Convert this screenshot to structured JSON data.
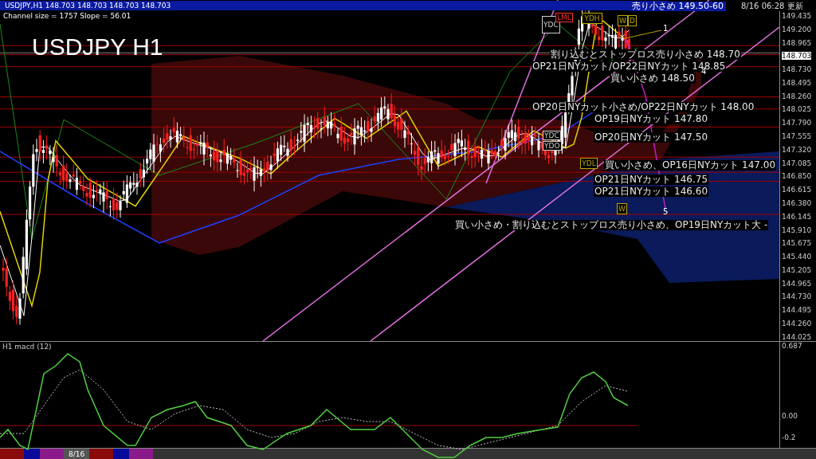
{
  "header": {
    "symbol_line": "USDJPY,H1  148.703 148.703 148.703 148.703",
    "channel_info": "Channel size = 1757 Slope = 56.01"
  },
  "chart_title": "USDJPY H1",
  "updated": "8/16 06:28 更新",
  "annotations": [
    {
      "kind": "banner",
      "text": "売り小さめ 149.50-60"
    },
    {
      "kind": "note",
      "text": "割り込むとストップロス売り小さめ 148.70"
    },
    {
      "kind": "note",
      "text": "OP21日NYカット/OP22日NYカット 148.85"
    },
    {
      "kind": "note",
      "text": "買い小さめ 148.50"
    },
    {
      "kind": "note",
      "text": "OP20日NYカット小さめ/OP22日NYカット 148.00"
    },
    {
      "kind": "note",
      "text": "OP19日NYカット 147.80"
    },
    {
      "kind": "note",
      "text": "OP20日NYカット 147.50"
    },
    {
      "kind": "note",
      "text": "買い小さめ、OP16日NYカット 147.00"
    },
    {
      "kind": "note",
      "text": "OP21日NYカット 146.75"
    },
    {
      "kind": "note",
      "text": "OP21日NYカット 146.60"
    },
    {
      "kind": "note",
      "text": "買い小さめ・割り込むとストップロス売り小さめ、OP19日NYカット大 -"
    }
  ],
  "level_boxes": [
    {
      "text": "YDC",
      "kind": "white"
    },
    {
      "text": "LML",
      "kind": "red"
    },
    {
      "text": "YDH",
      "kind": "yellow"
    },
    {
      "text": "W",
      "kind": "yellow"
    },
    {
      "text": "D",
      "kind": "yellow"
    },
    {
      "text": "YDC",
      "kind": "white"
    },
    {
      "text": "YDO",
      "kind": "white"
    },
    {
      "text": "YDL",
      "kind": "yellow"
    },
    {
      "text": "W",
      "kind": "yellow"
    }
  ],
  "wave_labels": [
    "1",
    "4",
    "5"
  ],
  "price_axis": {
    "labels": [
      "149.435",
      "149.200",
      "148.965",
      "148.730",
      "148.495",
      "148.260",
      "148.025",
      "147.790",
      "147.555",
      "147.320",
      "147.085",
      "146.850",
      "146.615",
      "146.380",
      "146.145",
      "145.910",
      "145.675",
      "145.440",
      "145.205",
      "144.965",
      "144.730",
      "144.495",
      "144.260",
      "144.025"
    ],
    "current": "148.703"
  },
  "macd": {
    "title": "H1  macd (12)",
    "axis_labels": [
      "0.687",
      "0.00",
      "-0.2"
    ]
  },
  "bottom_bar": {
    "date": "8/16"
  }
}
